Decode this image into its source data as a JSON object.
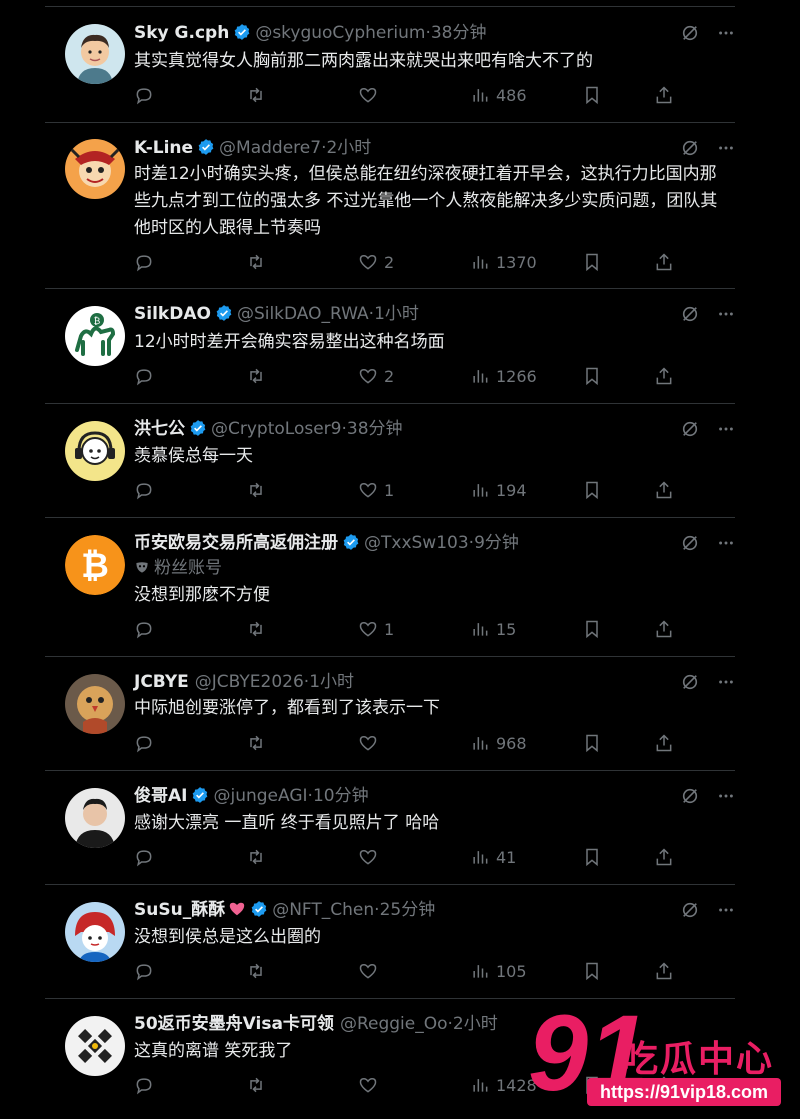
{
  "tweets": [
    {
      "name": "Sky G.cph",
      "handle": "@skyguoCypherium",
      "time": "38分钟",
      "text": "其实真觉得女人胸前那二两肉露出来就哭出来吧有啥大不了的",
      "replies": "",
      "retweets": "",
      "likes": "",
      "views": "486",
      "avatar": "avatar-cartoon-man"
    },
    {
      "name": "K-Line",
      "handle": "@Maddere7",
      "time": "2小时",
      "text": "时差12小时确实头疼，但侯总能在纽约深夜硬扛着开早会，这执行力比国内那些九点才到工位的强太多 不过光靠他一个人熬夜能解决多少实质问题，团队其他时区的人跟得上节奏吗",
      "replies": "",
      "retweets": "",
      "likes": "2",
      "views": "1370",
      "avatar": "avatar-monkey-mask"
    },
    {
      "name": "SilkDAO",
      "handle": "@SilkDAO_RWA",
      "time": "1小时",
      "text": "12小时时差开会确实容易整出这种名场面",
      "replies": "",
      "retweets": "",
      "likes": "2",
      "views": "1266",
      "avatar": "avatar-camel"
    },
    {
      "name": "洪七公",
      "handle": "@CryptoLoser9",
      "time": "38分钟",
      "text": "羡慕侯总每一天",
      "replies": "",
      "retweets": "",
      "likes": "1",
      "views": "194",
      "avatar": "avatar-headset"
    },
    {
      "name": "币安欧易交易所高返佣注册",
      "handle": "@TxxSw103",
      "time": "9分钟",
      "sub": "粉丝账号",
      "text": "没想到那麽不方便",
      "replies": "",
      "retweets": "",
      "likes": "1",
      "views": "15",
      "avatar": "avatar-bitcoin"
    },
    {
      "name": "JCBYE",
      "handle": "@JCBYE2026",
      "time": "1小时",
      "text": "中际旭创要涨停了，都看到了该表示一下",
      "replies": "",
      "retweets": "",
      "likes": "",
      "views": "968",
      "avatar": "avatar-bird"
    },
    {
      "name": "俊哥AI",
      "handle": "@jungeAGI",
      "time": "10分钟",
      "text": "感谢大漂亮 一直听 终于看见照片了 哈哈",
      "replies": "",
      "retweets": "",
      "likes": "",
      "views": "41",
      "avatar": "avatar-man-photo"
    },
    {
      "name": "SuSu_酥酥",
      "handle": "@NFT_Chen",
      "time": "25分钟",
      "text": "没想到侯总是这么出圈的",
      "replies": "",
      "retweets": "",
      "likes": "",
      "views": "105",
      "avatar": "avatar-cartoon-girl"
    },
    {
      "name": "50返币安墨舟Visa卡可领",
      "handle": "@Reggie_Oo",
      "time": "2小时",
      "text": "这真的离谱 笑死我了",
      "replies": "",
      "retweets": "",
      "likes": "",
      "views": "1428",
      "avatar": "avatar-binance"
    }
  ],
  "watermark": {
    "number": "91",
    "brand": "吃瓜中心",
    "url": "https://91vip18.com"
  },
  "colors": {
    "background": "#000000",
    "text": "#e7e9ea",
    "muted": "#71767b",
    "verified": "#1d9bf0",
    "divider": "#2f3336",
    "watermark": "#e91e63"
  }
}
